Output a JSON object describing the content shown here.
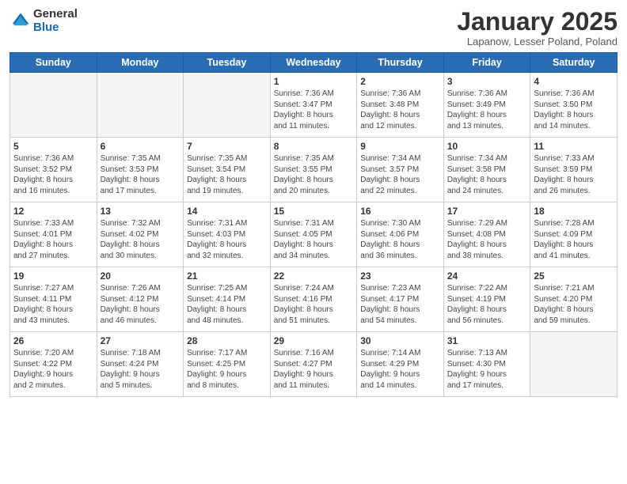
{
  "header": {
    "logo_general": "General",
    "logo_blue": "Blue",
    "month_title": "January 2025",
    "location": "Lapanow, Lesser Poland, Poland"
  },
  "weekdays": [
    "Sunday",
    "Monday",
    "Tuesday",
    "Wednesday",
    "Thursday",
    "Friday",
    "Saturday"
  ],
  "weeks": [
    [
      {
        "day": "",
        "info": ""
      },
      {
        "day": "",
        "info": ""
      },
      {
        "day": "",
        "info": ""
      },
      {
        "day": "1",
        "info": "Sunrise: 7:36 AM\nSunset: 3:47 PM\nDaylight: 8 hours\nand 11 minutes."
      },
      {
        "day": "2",
        "info": "Sunrise: 7:36 AM\nSunset: 3:48 PM\nDaylight: 8 hours\nand 12 minutes."
      },
      {
        "day": "3",
        "info": "Sunrise: 7:36 AM\nSunset: 3:49 PM\nDaylight: 8 hours\nand 13 minutes."
      },
      {
        "day": "4",
        "info": "Sunrise: 7:36 AM\nSunset: 3:50 PM\nDaylight: 8 hours\nand 14 minutes."
      }
    ],
    [
      {
        "day": "5",
        "info": "Sunrise: 7:36 AM\nSunset: 3:52 PM\nDaylight: 8 hours\nand 16 minutes."
      },
      {
        "day": "6",
        "info": "Sunrise: 7:35 AM\nSunset: 3:53 PM\nDaylight: 8 hours\nand 17 minutes."
      },
      {
        "day": "7",
        "info": "Sunrise: 7:35 AM\nSunset: 3:54 PM\nDaylight: 8 hours\nand 19 minutes."
      },
      {
        "day": "8",
        "info": "Sunrise: 7:35 AM\nSunset: 3:55 PM\nDaylight: 8 hours\nand 20 minutes."
      },
      {
        "day": "9",
        "info": "Sunrise: 7:34 AM\nSunset: 3:57 PM\nDaylight: 8 hours\nand 22 minutes."
      },
      {
        "day": "10",
        "info": "Sunrise: 7:34 AM\nSunset: 3:58 PM\nDaylight: 8 hours\nand 24 minutes."
      },
      {
        "day": "11",
        "info": "Sunrise: 7:33 AM\nSunset: 3:59 PM\nDaylight: 8 hours\nand 26 minutes."
      }
    ],
    [
      {
        "day": "12",
        "info": "Sunrise: 7:33 AM\nSunset: 4:01 PM\nDaylight: 8 hours\nand 27 minutes."
      },
      {
        "day": "13",
        "info": "Sunrise: 7:32 AM\nSunset: 4:02 PM\nDaylight: 8 hours\nand 30 minutes."
      },
      {
        "day": "14",
        "info": "Sunrise: 7:31 AM\nSunset: 4:03 PM\nDaylight: 8 hours\nand 32 minutes."
      },
      {
        "day": "15",
        "info": "Sunrise: 7:31 AM\nSunset: 4:05 PM\nDaylight: 8 hours\nand 34 minutes."
      },
      {
        "day": "16",
        "info": "Sunrise: 7:30 AM\nSunset: 4:06 PM\nDaylight: 8 hours\nand 36 minutes."
      },
      {
        "day": "17",
        "info": "Sunrise: 7:29 AM\nSunset: 4:08 PM\nDaylight: 8 hours\nand 38 minutes."
      },
      {
        "day": "18",
        "info": "Sunrise: 7:28 AM\nSunset: 4:09 PM\nDaylight: 8 hours\nand 41 minutes."
      }
    ],
    [
      {
        "day": "19",
        "info": "Sunrise: 7:27 AM\nSunset: 4:11 PM\nDaylight: 8 hours\nand 43 minutes."
      },
      {
        "day": "20",
        "info": "Sunrise: 7:26 AM\nSunset: 4:12 PM\nDaylight: 8 hours\nand 46 minutes."
      },
      {
        "day": "21",
        "info": "Sunrise: 7:25 AM\nSunset: 4:14 PM\nDaylight: 8 hours\nand 48 minutes."
      },
      {
        "day": "22",
        "info": "Sunrise: 7:24 AM\nSunset: 4:16 PM\nDaylight: 8 hours\nand 51 minutes."
      },
      {
        "day": "23",
        "info": "Sunrise: 7:23 AM\nSunset: 4:17 PM\nDaylight: 8 hours\nand 54 minutes."
      },
      {
        "day": "24",
        "info": "Sunrise: 7:22 AM\nSunset: 4:19 PM\nDaylight: 8 hours\nand 56 minutes."
      },
      {
        "day": "25",
        "info": "Sunrise: 7:21 AM\nSunset: 4:20 PM\nDaylight: 8 hours\nand 59 minutes."
      }
    ],
    [
      {
        "day": "26",
        "info": "Sunrise: 7:20 AM\nSunset: 4:22 PM\nDaylight: 9 hours\nand 2 minutes."
      },
      {
        "day": "27",
        "info": "Sunrise: 7:18 AM\nSunset: 4:24 PM\nDaylight: 9 hours\nand 5 minutes."
      },
      {
        "day": "28",
        "info": "Sunrise: 7:17 AM\nSunset: 4:25 PM\nDaylight: 9 hours\nand 8 minutes."
      },
      {
        "day": "29",
        "info": "Sunrise: 7:16 AM\nSunset: 4:27 PM\nDaylight: 9 hours\nand 11 minutes."
      },
      {
        "day": "30",
        "info": "Sunrise: 7:14 AM\nSunset: 4:29 PM\nDaylight: 9 hours\nand 14 minutes."
      },
      {
        "day": "31",
        "info": "Sunrise: 7:13 AM\nSunset: 4:30 PM\nDaylight: 9 hours\nand 17 minutes."
      },
      {
        "day": "",
        "info": ""
      }
    ]
  ]
}
